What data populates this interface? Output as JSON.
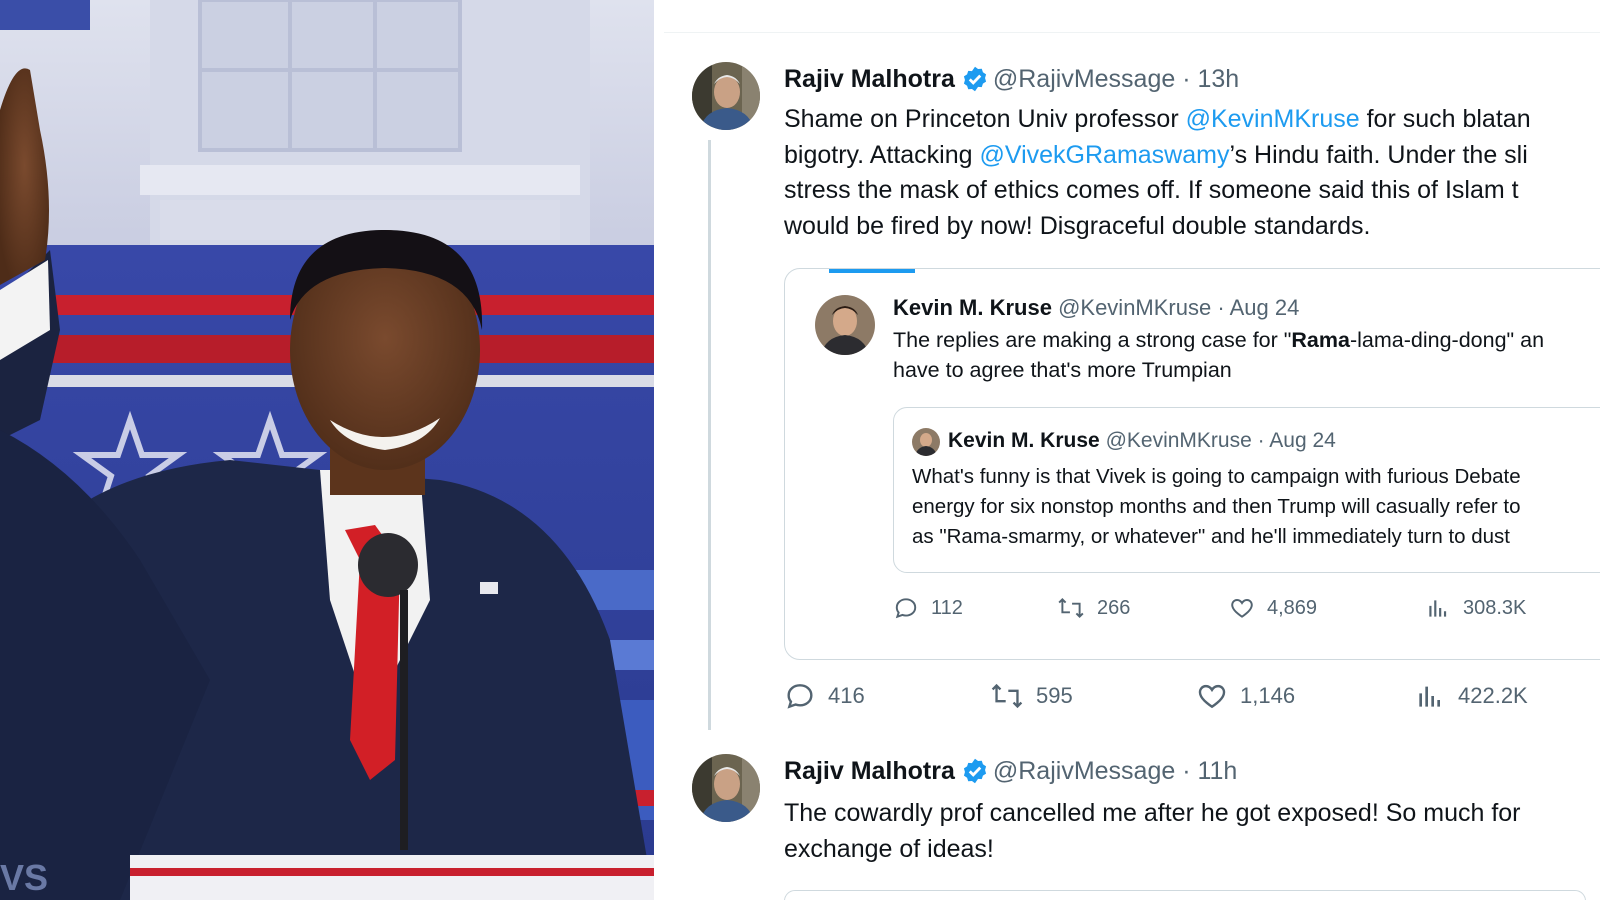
{
  "tweets": [
    {
      "author": "Rajiv Malhotra",
      "handle": "@RajivMessage",
      "time": "13h",
      "lines": [
        {
          "before": "Shame on Princeton Univ professor ",
          "mention": "@KevinMKruse",
          "after": " for such blatan"
        },
        {
          "before": "bigotry. Attacking ",
          "mention": "@VivekGRamaswamy",
          "after": "’s Hindu faith. Under the sli"
        },
        {
          "before": "stress the mask of ethics comes off. If someone said this of Islam t",
          "mention": "",
          "after": ""
        },
        {
          "before": "would be fired by now! Disgraceful double standards.",
          "mention": "",
          "after": ""
        }
      ],
      "quote": {
        "author": "Kevin M. Kruse",
        "handle": "@KevinMKruse",
        "date": "Aug 24",
        "line1_before": "The replies are making a strong case for \"",
        "line1_bold": "Rama",
        "line1_after": "-lama-ding-dong\" an",
        "line2": "have to agree that's more Trumpian",
        "inner": {
          "author": "Kevin M. Kruse",
          "handle": "@KevinMKruse",
          "date": "Aug 24",
          "lines": [
            "What's funny is that Vivek is going to campaign with furious Debate",
            "energy for six nonstop months and then Trump will casually refer to",
            "as \"Rama-smarmy, or whatever\" and he'll immediately turn to dust"
          ]
        },
        "stats": {
          "replies": "112",
          "retweets": "266",
          "likes": "4,869",
          "views": "308.3K"
        }
      },
      "stats": {
        "replies": "416",
        "retweets": "595",
        "likes": "1,146",
        "views": "422.2K"
      }
    },
    {
      "author": "Rajiv Malhotra",
      "handle": "@RajivMessage",
      "time": "11h",
      "lines": [
        "The cowardly prof cancelled me after he got exposed! So much for",
        "exchange of ideas!"
      ]
    }
  ],
  "icons": [
    "verified-badge-icon",
    "reply-icon",
    "retweet-icon",
    "like-icon",
    "views-icon"
  ],
  "colors": {
    "link": "#1d9bf0",
    "verified": "#1d9bf0",
    "muted": "#536471",
    "border": "#cfd9de"
  }
}
